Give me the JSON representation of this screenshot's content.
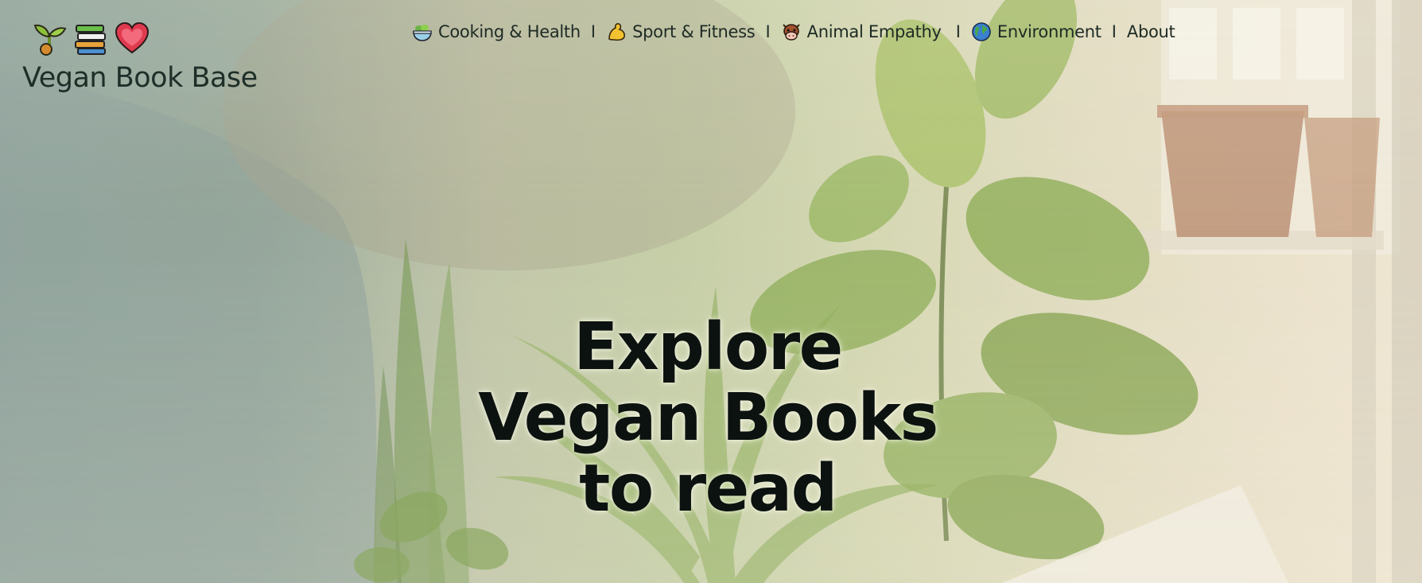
{
  "site": {
    "brand": "Vegan Book Base",
    "logo_icons": [
      "sprout-icon",
      "books-icon",
      "heart-icon"
    ]
  },
  "nav": {
    "items": [
      {
        "label": "Cooking & Health",
        "icon": "salad-bowl-icon"
      },
      {
        "label": "Sport & Fitness",
        "icon": "flexed-biceps-icon"
      },
      {
        "label": "Animal Empathy",
        "icon": "cow-face-icon"
      },
      {
        "label": "Environment",
        "icon": "globe-icon"
      },
      {
        "label": "About"
      }
    ],
    "separator": "I"
  },
  "hero": {
    "headline_lines": [
      "Explore",
      "Vegan Books",
      "to read"
    ]
  },
  "colors": {
    "text_dark": "#1d2a24",
    "headline": "#0c120f",
    "leaf_green": "#7f9a52",
    "heart_red": "#e03a4e"
  }
}
